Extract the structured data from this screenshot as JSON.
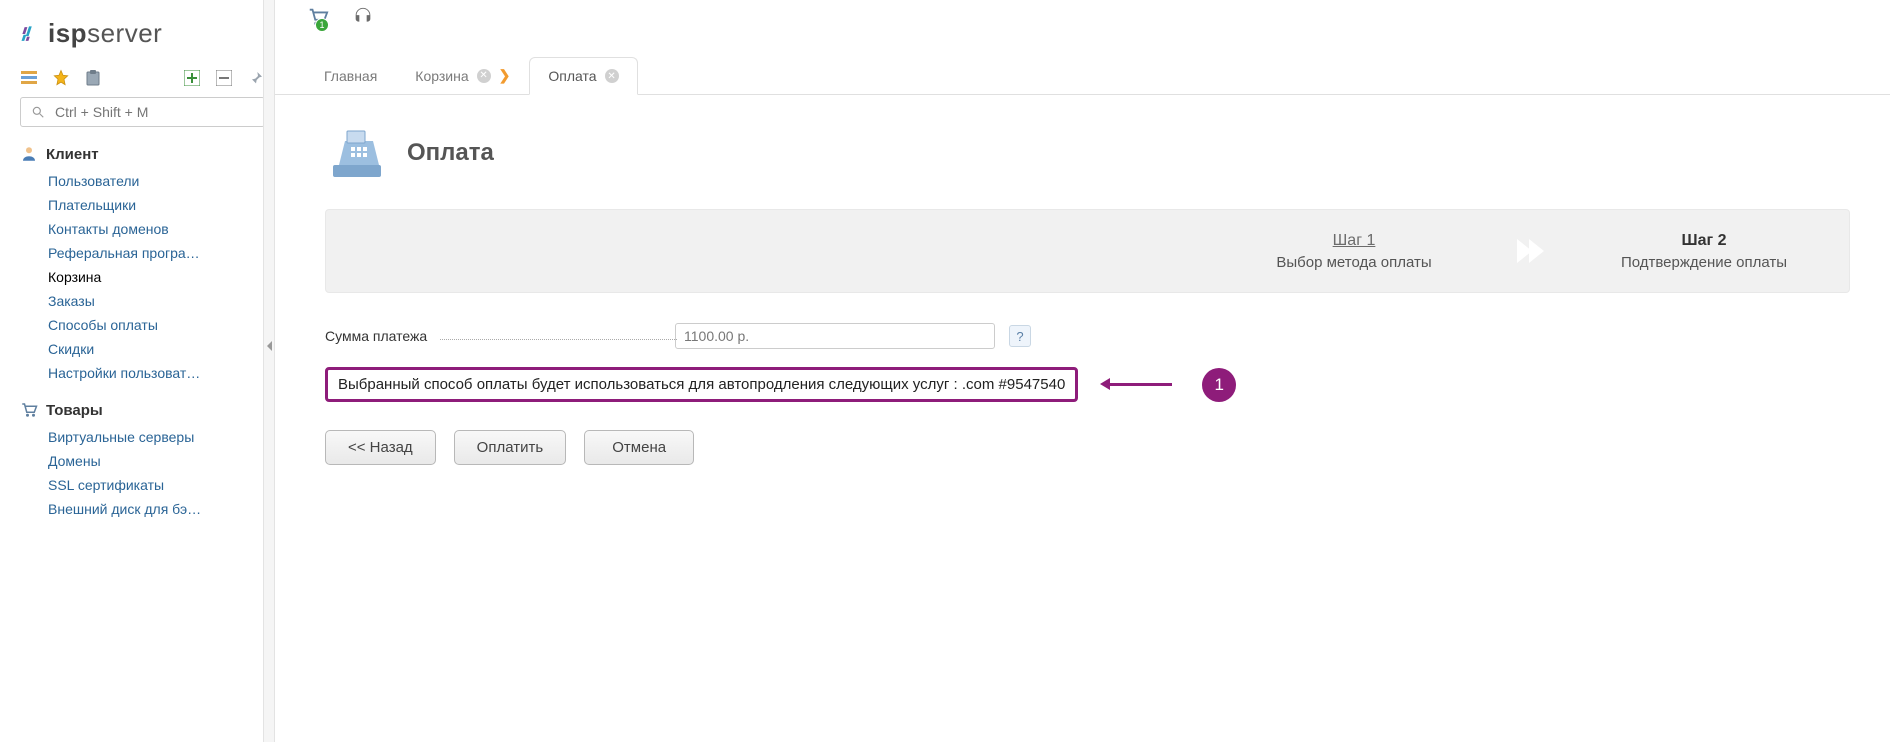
{
  "logo": {
    "bold": "isp",
    "rest": "server"
  },
  "search": {
    "placeholder": "Ctrl + Shift + M"
  },
  "sidebar": {
    "groups": [
      {
        "title": "Клиент",
        "icon": "user-icon",
        "items": [
          {
            "label": "Пользователи"
          },
          {
            "label": "Плательщики"
          },
          {
            "label": "Контакты доменов"
          },
          {
            "label": "Реферальная програ…"
          },
          {
            "label": "Корзина",
            "active": true
          },
          {
            "label": "Заказы"
          },
          {
            "label": "Способы оплаты"
          },
          {
            "label": "Скидки"
          },
          {
            "label": "Настройки пользоват…"
          }
        ]
      },
      {
        "title": "Товары",
        "icon": "cart-icon",
        "items": [
          {
            "label": "Виртуальные серверы"
          },
          {
            "label": "Домены"
          },
          {
            "label": "SSL сертификаты"
          },
          {
            "label": "Внешний диск для бэ…"
          }
        ]
      }
    ]
  },
  "top": {
    "cart_badge": "1"
  },
  "tabs": {
    "home": "Главная",
    "cart": "Корзина",
    "payment": "Оплата"
  },
  "page": {
    "title": "Оплата",
    "steps": {
      "s1_title": "Шаг 1",
      "s1_sub": "Выбор метода оплаты",
      "s2_title": "Шаг 2",
      "s2_sub": "Подтверждение оплаты"
    },
    "form": {
      "amount_label": "Сумма платежа",
      "amount_value": "1100.00 р.",
      "help": "?"
    },
    "notice": "Выбранный способ оплаты будет использоваться для автопродления следующих услуг : .com #9547540",
    "annotation": "1",
    "buttons": {
      "back": "<< Назад",
      "pay": "Оплатить",
      "cancel": "Отмена"
    }
  }
}
